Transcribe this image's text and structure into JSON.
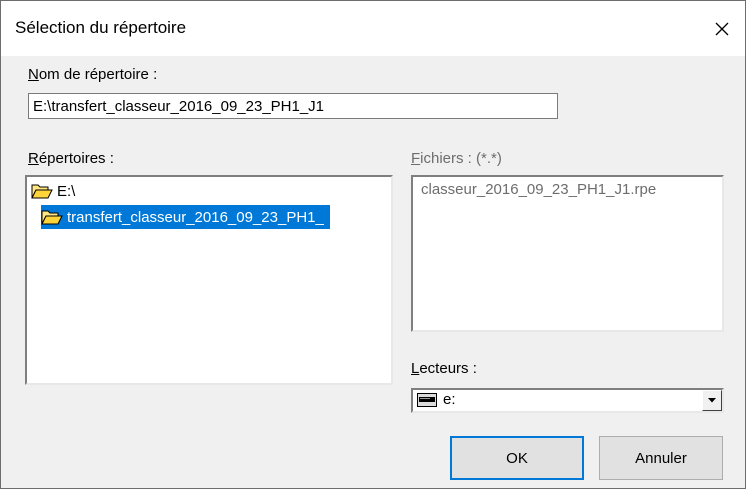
{
  "window": {
    "title": "Sélection du répertoire"
  },
  "dirname": {
    "label_first": "N",
    "label_rest": "om de répertoire :",
    "value": "E:\\transfert_classeur_2016_09_23_PH1_J1"
  },
  "directories": {
    "label_first": "R",
    "label_rest": "épertoires :",
    "items": [
      {
        "text": "E:\\",
        "selected": false
      },
      {
        "text": "transfert_classeur_2016_09_23_PH1_",
        "selected": true
      }
    ]
  },
  "files": {
    "label_first": "F",
    "label_rest": "ichiers : (*.*)",
    "items": [
      "classeur_2016_09_23_PH1_J1.rpe"
    ]
  },
  "drives": {
    "label_first": "L",
    "label_rest": "ecteurs :",
    "selected": "e:"
  },
  "buttons": {
    "ok": "OK",
    "cancel": "Annuler"
  },
  "icons": {
    "close": "close-icon",
    "folder": "folder-open-icon",
    "drive": "drive-icon",
    "dropdown": "chevron-down-icon"
  },
  "colors": {
    "selection": "#0078d7",
    "disabled_text": "#6d6d6d",
    "dialog_bg": "#f0f0f0"
  }
}
